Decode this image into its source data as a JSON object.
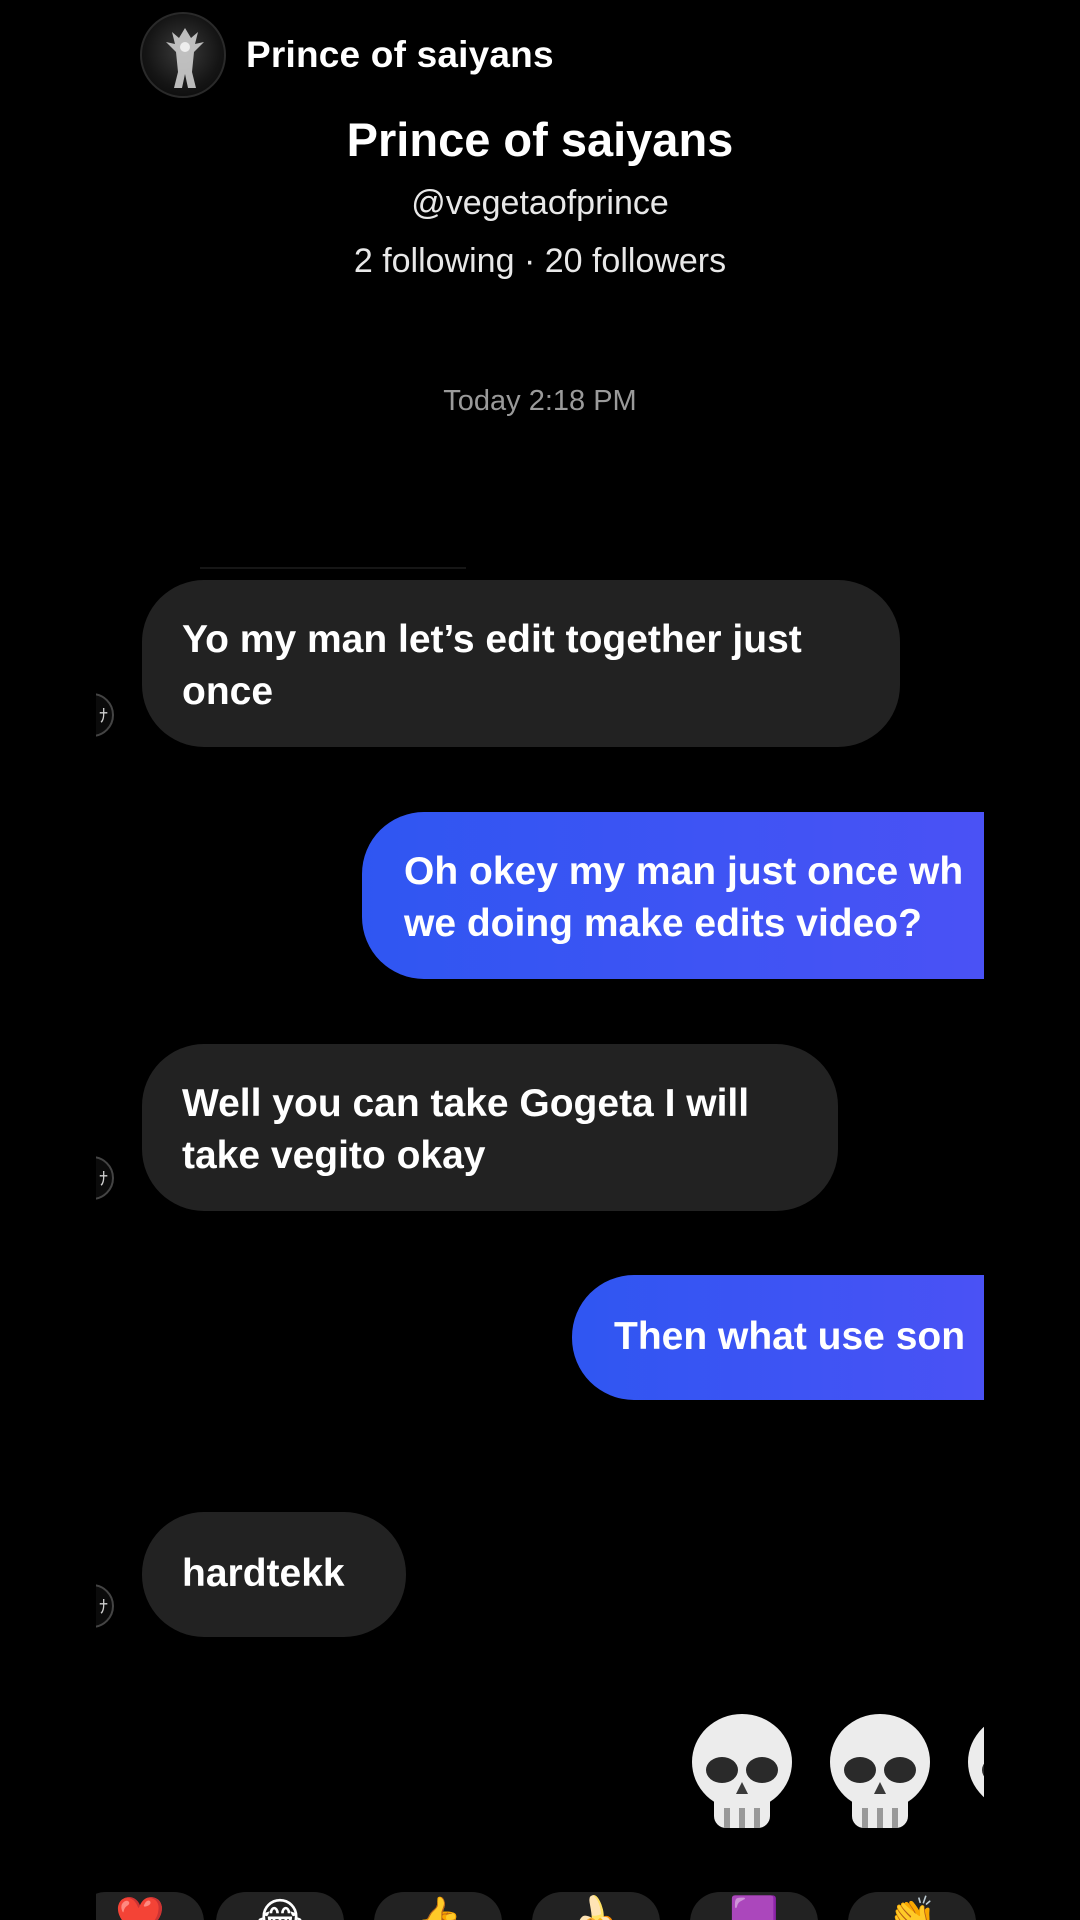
{
  "header": {
    "title": "Prince of saiyans",
    "avatar_icon": "saiyan-silhouette-avatar"
  },
  "profile": {
    "name": "Prince of saiyans",
    "handle": "@vegetaofprince",
    "stats": "2 following · 20 followers"
  },
  "chat": {
    "timestamp": "Today 2:18 PM",
    "messages": [
      {
        "side": "in",
        "lines": [
          "Yo my man let’s edit together just",
          "once"
        ]
      },
      {
        "side": "out",
        "lines": [
          "Oh okey my man just once wh",
          "we doing make edits video?"
        ]
      },
      {
        "side": "in",
        "lines": [
          "Well you can take Gogeta I will",
          "take vegito okay"
        ]
      },
      {
        "side": "out",
        "lines": [
          "Then what use son"
        ]
      },
      {
        "side": "in",
        "lines": [
          "hardtekk"
        ]
      }
    ],
    "emoji_reply": "💀💀💀"
  },
  "reaction_bar": {
    "items": [
      "❤️",
      "😂",
      "👍",
      "🍌",
      "🟪",
      "👏"
    ]
  },
  "colors": {
    "background": "#000000",
    "incoming_bubble": "#222222",
    "outgoing_bubble_start": "#2f56f2",
    "outgoing_bubble_end": "#4a52f5",
    "timestamp": "#9a9a9a"
  }
}
